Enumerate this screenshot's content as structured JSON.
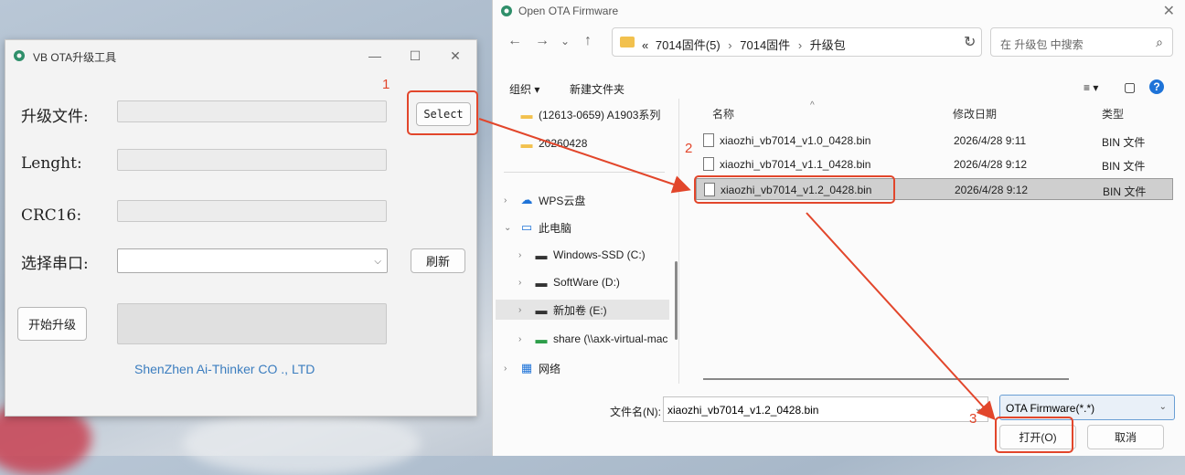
{
  "ota_window": {
    "title": "VB OTA升级工具",
    "min_glyph": "—",
    "max_glyph": "☐",
    "close_glyph": "✕",
    "labels": {
      "upgrade_file": "升级文件:",
      "length": "Lenght:",
      "crc16": "CRC16:",
      "serial_port": "选择串口:"
    },
    "buttons": {
      "select": "Select",
      "refresh": "刷新",
      "start": "开始升级"
    },
    "combo_chevron": "⌵",
    "company": "ShenZhen Ai-Thinker CO ., LTD"
  },
  "dialog": {
    "title": "Open OTA Firmware",
    "close_glyph": "✕",
    "nav": {
      "back": "←",
      "forward": "→",
      "history": "⌄",
      "up": "↑"
    },
    "breadcrumb": [
      "7014固件(5)",
      "7014固件",
      "升级包"
    ],
    "breadcrumb_prefix": "«",
    "breadcrumb_sep": "›",
    "address_chevron": "⌄",
    "refresh_glyph": "↻",
    "search_placeholder": "在 升级包 中搜索",
    "search_glyph": "⌕",
    "toolbar": {
      "organize": "组织 ▾",
      "new_folder": "新建文件夹",
      "view_glyph": "≡ ▾",
      "pane_glyph": "▢",
      "help_glyph": "?"
    },
    "sidebar": [
      {
        "label": "(12613-0659) A1903系列",
        "expander": "",
        "icon": "folder-icon",
        "glyph": "▬"
      },
      {
        "label": "20260428",
        "expander": "",
        "icon": "folder-icon",
        "glyph": "▬"
      },
      {
        "label": "WPS云盘",
        "expander": "›",
        "icon": "cloud-icon",
        "glyph": "☁"
      },
      {
        "label": "此电脑",
        "expander": "⌄",
        "icon": "computer-icon",
        "glyph": "▭"
      },
      {
        "label": "Windows-SSD (C:)",
        "expander": "›",
        "icon": "drive-icon",
        "glyph": "▬"
      },
      {
        "label": "SoftWare (D:)",
        "expander": "›",
        "icon": "drive-icon",
        "glyph": "▬"
      },
      {
        "label": "新加卷 (E:)",
        "expander": "›",
        "icon": "drive-icon",
        "glyph": "▬"
      },
      {
        "label": "share (\\\\axk-virtual-mac",
        "expander": "›",
        "icon": "network-drive-icon",
        "glyph": "▬"
      },
      {
        "label": "网络",
        "expander": "›",
        "icon": "network-icon",
        "glyph": "▦"
      }
    ],
    "columns": {
      "name": "名称",
      "modified": "修改日期",
      "type": "类型"
    },
    "sort_arrow": "^",
    "files": [
      {
        "name": "xiaozhi_vb7014_v1.0_0428.bin",
        "modified": "2026/4/28 9:11",
        "type": "BIN 文件",
        "selected": false
      },
      {
        "name": "xiaozhi_vb7014_v1.1_0428.bin",
        "modified": "2026/4/28 9:12",
        "type": "BIN 文件",
        "selected": false
      },
      {
        "name": "xiaozhi_vb7014_v1.2_0428.bin",
        "modified": "2026/4/28 9:12",
        "type": "BIN 文件",
        "selected": true
      }
    ],
    "filename_label": "文件名(N):",
    "filename_value": "xiaozhi_vb7014_v1.2_0428.bin",
    "filetype_value": "OTA Firmware(*.*)",
    "select_chevron": "⌄",
    "open_button": "打开(O)",
    "cancel_button": "取消"
  },
  "annotations": {
    "step1": "1",
    "step2": "2",
    "step3": "3",
    "color": "#e2462b"
  }
}
